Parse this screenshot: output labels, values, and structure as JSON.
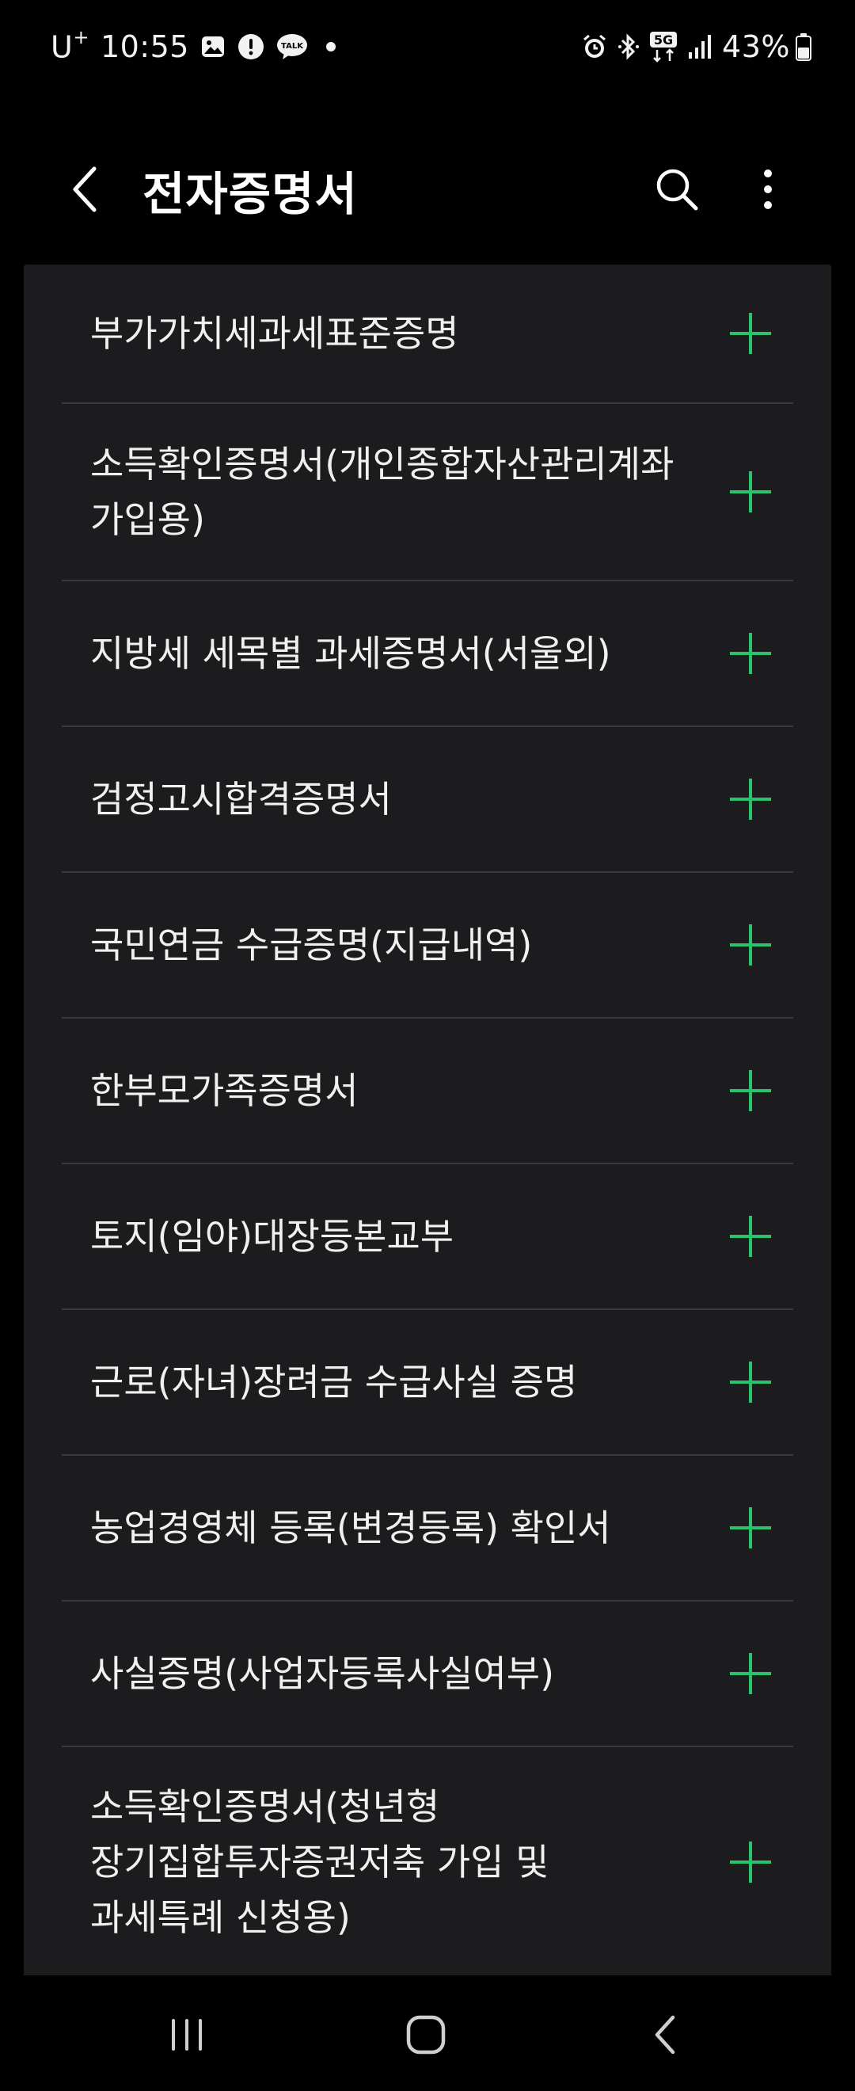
{
  "status_bar": {
    "carrier": "U",
    "carrier_sup": "+",
    "time": "10:55",
    "network": "5G",
    "battery": "43%"
  },
  "app_bar": {
    "title": "전자증명서",
    "back_icon": "chevron-left-icon",
    "search_icon": "search-icon",
    "more_icon": "more-vert-icon"
  },
  "accent_color": "#27c46b",
  "items": [
    {
      "label": "부가가치세과세표준증명"
    },
    {
      "label": "소득확인증명서(개인종합자산관리계좌\n가입용)"
    },
    {
      "label": "지방세 세목별 과세증명서(서울외)"
    },
    {
      "label": "검정고시합격증명서"
    },
    {
      "label": "국민연금 수급증명(지급내역)"
    },
    {
      "label": "한부모가족증명서"
    },
    {
      "label": "토지(임야)대장등본교부"
    },
    {
      "label": "근로(자녀)장려금 수급사실 증명"
    },
    {
      "label": "농업경영체 등록(변경등록) 확인서"
    },
    {
      "label": "사실증명(사업자등록사실여부)"
    },
    {
      "label": "소득확인증명서(청년형\n장기집합투자증권저축 가입 및\n과세특례 신청용)"
    }
  ],
  "nav_bar": {
    "recents_icon": "recents-icon",
    "home_icon": "home-icon",
    "back_icon": "nav-back-icon"
  }
}
